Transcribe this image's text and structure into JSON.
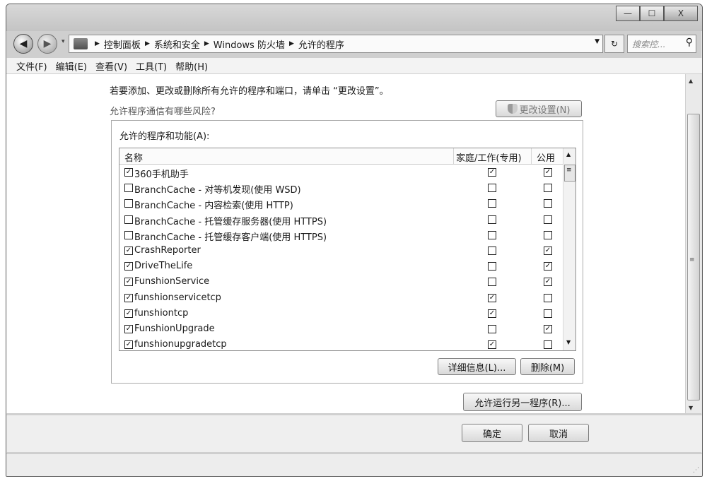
{
  "window": {
    "minimize_glyph": "—",
    "maximize_glyph": "☐",
    "close_glyph": "X"
  },
  "navigation": {
    "back_glyph": "◀",
    "forward_glyph": "▶",
    "breadcrumbs": [
      "控制面板",
      "系统和安全",
      "Windows 防火墙",
      "允许的程序"
    ],
    "refresh_glyph": "↻",
    "search_placeholder": "搜索控..."
  },
  "menu": [
    "文件(F)",
    "编辑(E)",
    "查看(V)",
    "工具(T)",
    "帮助(H)"
  ],
  "main": {
    "instruction": "若要添加、更改或删除所有允许的程序和端口，请单击 “更改设置”。",
    "risk_link": "允许程序通信有哪些风险?",
    "change_settings_button": "更改设置(N)",
    "group_label": "允许的程序和功能(A):",
    "columns": {
      "name": "名称",
      "home": "家庭/工作(专用)",
      "public": "公用"
    },
    "rows": [
      {
        "name": "360手机助手",
        "enabled": true,
        "home": true,
        "public": true
      },
      {
        "name": "BranchCache - 对等机发现(使用 WSD)",
        "enabled": false,
        "home": false,
        "public": false
      },
      {
        "name": "BranchCache - 内容检索(使用 HTTP)",
        "enabled": false,
        "home": false,
        "public": false
      },
      {
        "name": "BranchCache - 托管缓存服务器(使用 HTTPS)",
        "enabled": false,
        "home": false,
        "public": false
      },
      {
        "name": "BranchCache - 托管缓存客户端(使用 HTTPS)",
        "enabled": false,
        "home": false,
        "public": false
      },
      {
        "name": "CrashReporter",
        "enabled": true,
        "home": false,
        "public": true
      },
      {
        "name": "DriveTheLife",
        "enabled": true,
        "home": false,
        "public": true
      },
      {
        "name": "FunshionService",
        "enabled": true,
        "home": false,
        "public": true
      },
      {
        "name": "funshionservicetcp",
        "enabled": true,
        "home": true,
        "public": false
      },
      {
        "name": "funshiontcp",
        "enabled": true,
        "home": true,
        "public": false
      },
      {
        "name": "FunshionUpgrade",
        "enabled": true,
        "home": false,
        "public": true
      },
      {
        "name": "funshionupgradetcp",
        "enabled": true,
        "home": true,
        "public": false
      }
    ],
    "details_button": "详细信息(L)...",
    "remove_button": "删除(M)",
    "allow_another_button": "允许运行另一程序(R)..."
  },
  "footer": {
    "ok_button": "确定",
    "cancel_button": "取消"
  }
}
